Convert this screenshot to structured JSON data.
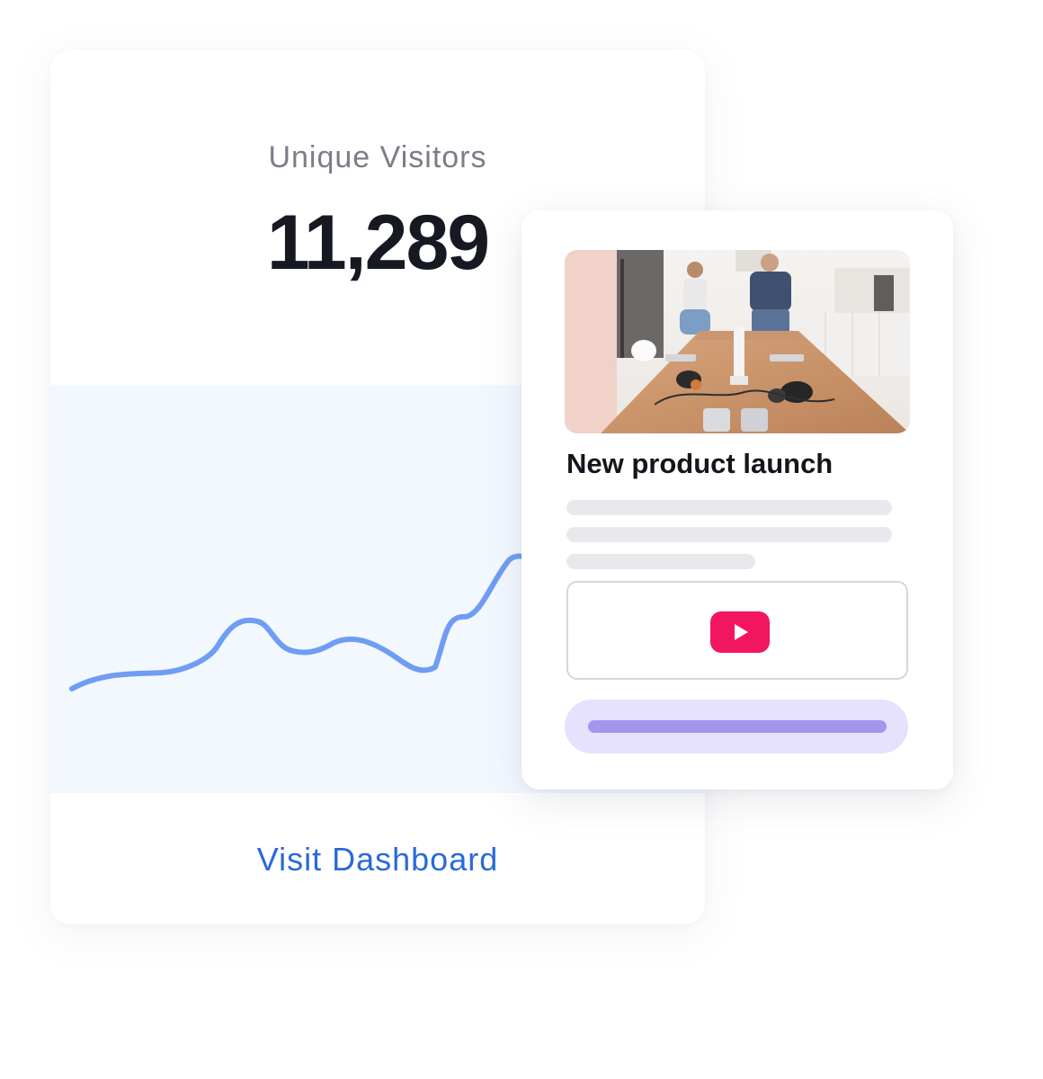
{
  "stats_card": {
    "label": "Unique Visitors",
    "value": "11,289",
    "link_label": "Visit Dashboard"
  },
  "promo_card": {
    "title": "New product launch",
    "image": "office room with people standing around a wooden table with headphones and phones",
    "video_icon": "play-icon"
  },
  "colors": {
    "chart_line": "#6f9cf4",
    "chart_background": "#f3f8ff",
    "link": "#2a6ad9",
    "play_button": "#f2165f",
    "cta_fill": "#e6e1fc",
    "cta_bar": "#a296ef"
  }
}
